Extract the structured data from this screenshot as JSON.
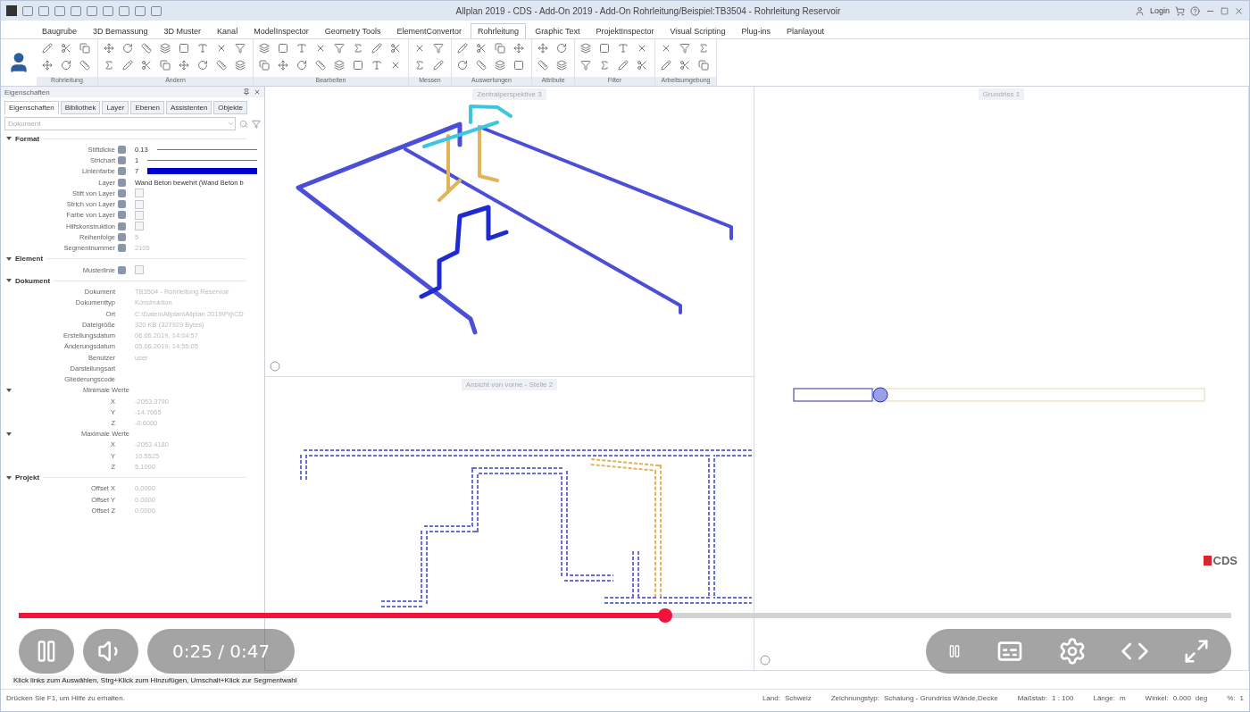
{
  "window": {
    "title": "Allplan 2019 - CDS - Add-On 2019 - Add-On Rohrleitung/Beispiel:TB3504 - Rohrleitung Reservoir",
    "login": "Login"
  },
  "ribbon": {
    "tabs": [
      {
        "label": "Baugrube",
        "selected": false
      },
      {
        "label": "3D Bemassung",
        "selected": false
      },
      {
        "label": "3D Muster",
        "selected": false
      },
      {
        "label": "Kanal",
        "selected": false
      },
      {
        "label": "ModelInspector",
        "selected": false
      },
      {
        "label": "Geometry Tools",
        "selected": false
      },
      {
        "label": "ElementConvertor",
        "selected": false
      },
      {
        "label": "Rohrleitung",
        "selected": true
      },
      {
        "label": "Graphic Text",
        "selected": false
      },
      {
        "label": "ProjektInspector",
        "selected": false
      },
      {
        "label": "Visual Scripting",
        "selected": false
      },
      {
        "label": "Plug-ins",
        "selected": false
      },
      {
        "label": "Planlayout",
        "selected": false
      }
    ],
    "groups": [
      {
        "label": "Rohrleitung"
      },
      {
        "label": "Ändern"
      },
      {
        "label": "Bearbeiten"
      },
      {
        "label": "Messen"
      },
      {
        "label": "Auswertungen"
      },
      {
        "label": "Attribute"
      },
      {
        "label": "Filter"
      },
      {
        "label": "Arbeitsumgebung"
      }
    ]
  },
  "properties_panel": {
    "title": "Eigenschaften",
    "tabs": [
      {
        "label": "Eigenschaften",
        "selected": true
      },
      {
        "label": "Bibliothek",
        "selected": false
      },
      {
        "label": "Layer",
        "selected": false
      },
      {
        "label": "Ebenen",
        "selected": false
      },
      {
        "label": "Assistenten",
        "selected": false
      },
      {
        "label": "Objekte",
        "selected": false
      }
    ],
    "selector": {
      "value": "Dokument"
    },
    "sections": [
      {
        "title": "Format",
        "expanded": true,
        "rows": [
          {
            "kind": "line",
            "label": "Stiftdicke",
            "value": "0.13"
          },
          {
            "kind": "line",
            "label": "Strichart",
            "value": "1"
          },
          {
            "kind": "color",
            "label": "Linienfarbe",
            "value": "7",
            "color": "#0000cc"
          },
          {
            "kind": "text",
            "label": "Layer",
            "value": "Wand Beton bewehrt (Wand Beton b"
          },
          {
            "kind": "checkbox",
            "label": "Stift von Layer",
            "checked": false
          },
          {
            "kind": "checkbox",
            "label": "Strich von Layer",
            "checked": false
          },
          {
            "kind": "checkbox",
            "label": "Farbe von Layer",
            "checked": false
          },
          {
            "kind": "checkbox",
            "label": "Hilfskonstruktion",
            "checked": false
          },
          {
            "kind": "readonly",
            "label": "Reihenfolge",
            "value": "5"
          },
          {
            "kind": "readonly",
            "label": "Segmentnummer",
            "value": "2105"
          }
        ]
      },
      {
        "title": "Element",
        "expanded": true,
        "rows": [
          {
            "kind": "checkbox",
            "label": "Musterlinie",
            "checked": false
          }
        ]
      },
      {
        "title": "Dokument",
        "expanded": true,
        "rows": [
          {
            "kind": "readonly",
            "label": "Dokument",
            "value": "TB3504 - Rohrleitung Reservoir"
          },
          {
            "kind": "readonly",
            "label": "Dokumenttyp",
            "value": "Konstruktion"
          },
          {
            "kind": "readonly",
            "label": "Ort",
            "value": "C:\\Daten\\Allplan\\Allplan 2019\\Prj\\CD"
          },
          {
            "kind": "readonly",
            "label": "Dateigröße",
            "value": "320 KB (327929 Bytes)"
          },
          {
            "kind": "readonly",
            "label": "Erstellungsdatum",
            "value": "06.06.2019, 14:04:57"
          },
          {
            "kind": "readonly",
            "label": "Änderungsdatum",
            "value": "05.06.2019, 14:55:05"
          },
          {
            "kind": "readonly",
            "label": "Benutzer",
            "value": "user"
          },
          {
            "kind": "readonly",
            "label": "Darstellungsart"
          },
          {
            "kind": "readonly",
            "label": "Gliederungscode"
          },
          {
            "kind": "group",
            "label": "Minimale Werte",
            "expanded": true,
            "children": [
              {
                "kind": "readonly",
                "label": "X",
                "value": "-2053.3790"
              },
              {
                "kind": "readonly",
                "label": "Y",
                "value": "-14.7065"
              },
              {
                "kind": "readonly",
                "label": "Z",
                "value": "-0.6000"
              }
            ]
          },
          {
            "kind": "group",
            "label": "Maximale Werte",
            "expanded": true,
            "children": [
              {
                "kind": "readonly",
                "label": "X",
                "value": "-2053.4180"
              },
              {
                "kind": "readonly",
                "label": "Y",
                "value": "10.5525"
              },
              {
                "kind": "readonly",
                "label": "Z",
                "value": "5.1000"
              }
            ]
          }
        ]
      },
      {
        "title": "Projekt",
        "expanded": true,
        "rows": [
          {
            "kind": "readonly",
            "label": "Offset X",
            "value": "0.0000"
          },
          {
            "kind": "readonly",
            "label": "Offset Y",
            "value": "0.0000"
          },
          {
            "kind": "readonly",
            "label": "Offset Z",
            "value": "0.0000"
          }
        ]
      }
    ]
  },
  "viewports": [
    {
      "kind": "perspective",
      "title": "Zentralperspektive 3"
    },
    {
      "kind": "elevation",
      "title": "Ansicht von vorne - Stelle 2"
    },
    {
      "kind": "plan",
      "title": "Grundriss 1",
      "logo_text": "CDS"
    }
  ],
  "hint": "Klick links zum Auswählen, Strg+Klick zum Hinzufügen, Umschalt+Klick zur Segmentwahl",
  "status_bar": {
    "help": "Drücken Sie F1, um Hilfe zu erhalten.",
    "fields": [
      {
        "label": "Land:",
        "value": "Schweiz"
      },
      {
        "label": "Zeichnungstyp:",
        "value": "Schalung - Grundriss Wände,Decke"
      },
      {
        "label": "Maßstab:",
        "value": "1 : 100"
      },
      {
        "label": "Länge:",
        "value": "m"
      },
      {
        "label": "Winkel:",
        "value": "0.000",
        "unit": "deg"
      },
      {
        "label": "%:",
        "value": "1"
      }
    ]
  },
  "video_player": {
    "playing": true,
    "time": "0:25 / 0:47",
    "progress": {
      "level": 0.533
    }
  }
}
